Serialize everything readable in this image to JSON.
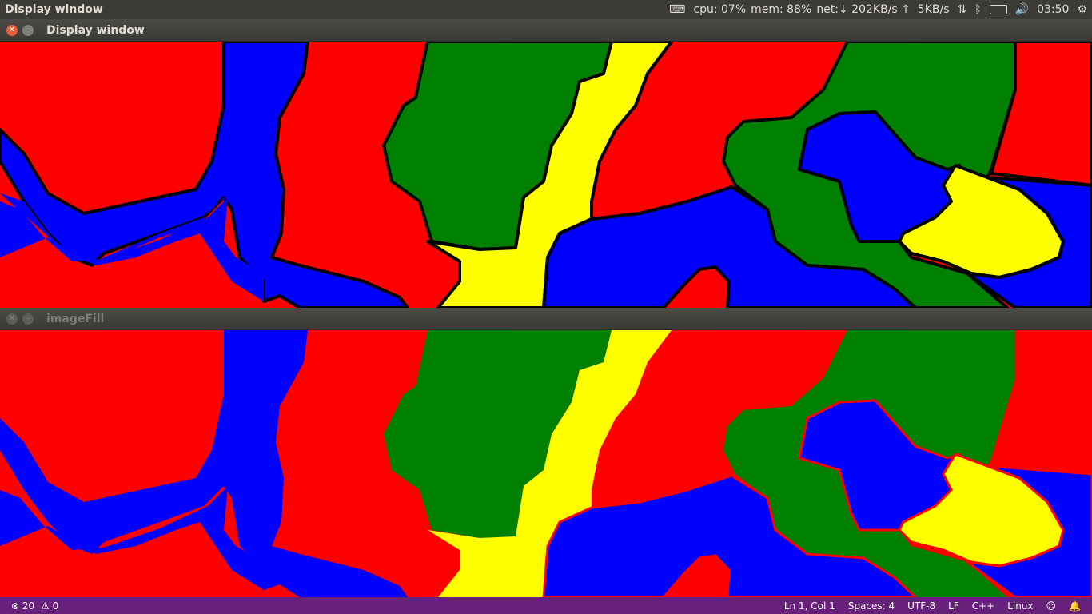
{
  "topbar": {
    "app_name": "Display window",
    "cpu": "cpu: 07%",
    "mem": "mem: 88%",
    "net": "net:↓ 202KB/s ↑  5KB/s",
    "time": "03:50",
    "icons": [
      "keyboard-icon",
      "network-arrows-icon",
      "bluetooth-icon",
      "battery-icon",
      "volume-icon",
      "gear-icon"
    ]
  },
  "window1": {
    "title": "Display window",
    "active": true
  },
  "window2": {
    "title": "imageFill",
    "active": false
  },
  "statusbar": {
    "errors": "20",
    "warnings": "0",
    "position": "Ln 1, Col 1",
    "spaces": "Spaces: 4",
    "encoding": "UTF-8",
    "eol": "LF",
    "language": "C++",
    "platform": "Linux"
  },
  "colors": {
    "red": "#ff0000",
    "blue": "#0000ff",
    "green": "#008000",
    "yellow": "#ffff00",
    "outline": "#000000",
    "fill_outline": "#ff0000",
    "statusbar": "#68217a",
    "topbar": "#3c3b37"
  }
}
